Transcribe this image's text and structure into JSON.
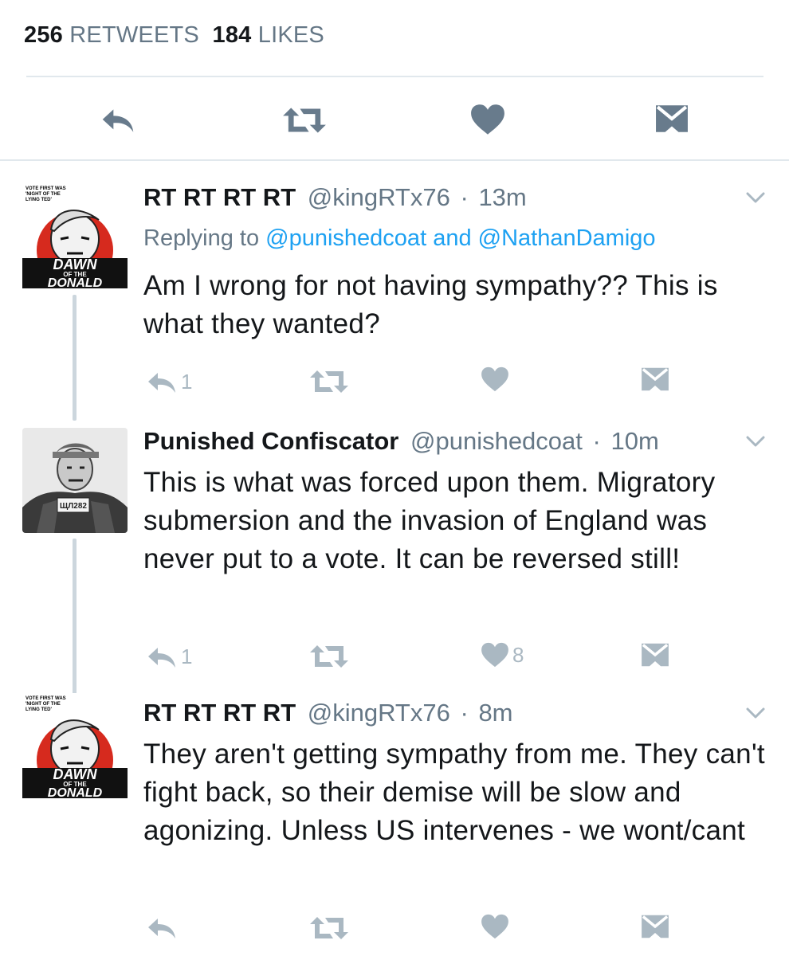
{
  "stats": {
    "retweets_count": "256",
    "retweets_label": "RETWEETS",
    "likes_count": "184",
    "likes_label": "LIKES"
  },
  "main_actions": [
    "reply-icon",
    "retweet-icon",
    "like-icon",
    "direct-message-icon"
  ],
  "colors": {
    "icon_main": "#687b8c",
    "icon_small": "#aab8c2",
    "link": "#1da1f2",
    "secondary_text": "#657786",
    "thread_line": "#ccd6dd"
  },
  "tweets": [
    {
      "name": "RT RT RT RT",
      "handle": "@kingRTx76",
      "dot": "·",
      "time": "13m",
      "replying_prefix": "Replying to",
      "replying_user1": "@punishedcoat",
      "replying_and": "and",
      "replying_user2": "@NathanDamigo",
      "text": "Am I wrong for not having sympathy?? This is what they wanted?",
      "reply_count": "1",
      "retweet_count": "",
      "like_count": "",
      "avatar_text": {
        "top1": "VOTE FIRST WAS",
        "top2": "'NIGHT OF THE",
        "top3": "LYING TED'",
        "main": "DAWN",
        "sub": "OF THE",
        "bottom": "DONALD"
      }
    },
    {
      "name": "Punished Confiscator",
      "handle": "@punishedcoat",
      "dot": "·",
      "time": "10m",
      "text": "This is what was forced upon them. Migratory submersion and the invasion of England was never put to a vote. It can be reversed still!",
      "reply_count": "1",
      "retweet_count": "",
      "like_count": "8",
      "avatar_text": {
        "badge": "ЩЛ282"
      }
    },
    {
      "name": "RT RT RT RT",
      "handle": "@kingRTx76",
      "dot": "·",
      "time": "8m",
      "text": "They aren't getting sympathy from me. They can't fight back, so their demise will be slow and agonizing. Unless US intervenes - we wont/cant",
      "reply_count": "",
      "retweet_count": "",
      "like_count": "",
      "avatar_text": {
        "top1": "VOTE FIRST WAS",
        "top2": "'NIGHT OF THE",
        "top3": "LYING TED'",
        "main": "DAWN",
        "sub": "OF THE",
        "bottom": "DONALD"
      }
    }
  ]
}
